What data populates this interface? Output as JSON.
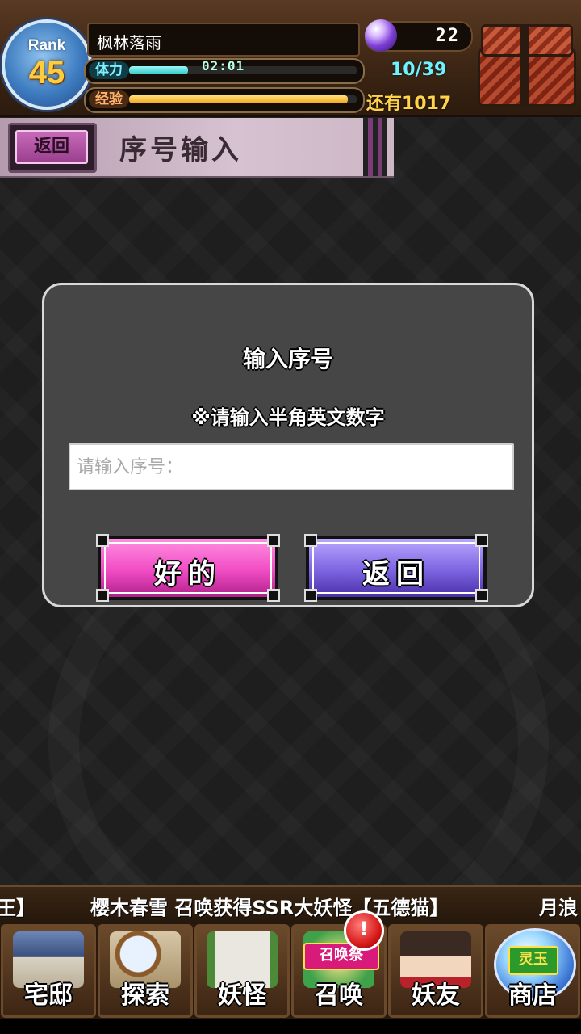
{
  "header": {
    "rank_label": "Rank",
    "rank_level": "45",
    "player_name": "枫林落雨",
    "stamina_label": "体力",
    "stamina_timer": "02:01",
    "stamina_count": "10/39",
    "stamina_fill_fraction": 0.26,
    "exp_label": "经验",
    "exp_remaining": "还有1017",
    "exp_fill_fraction": 0.96,
    "gem_count": "22"
  },
  "page": {
    "back_label": "返回",
    "title": "序号输入"
  },
  "dialog": {
    "title": "输入序号",
    "note": "※请输入半角英文数字",
    "input_placeholder": "请输入序号：",
    "input_value": "",
    "ok_label": "好的",
    "cancel_label": "返回"
  },
  "ticker": {
    "left_fragment": "王】",
    "message": "樱木春雪 召唤获得SSR大妖怪【五德猫】",
    "right_fragment": "月浪"
  },
  "bottom_nav": {
    "items": [
      {
        "label": "宅邸",
        "icon": "mansion-icon"
      },
      {
        "label": "探索",
        "icon": "magnifier-map-icon"
      },
      {
        "label": "妖怪",
        "icon": "yokai-scroll-icon"
      },
      {
        "label": "召唤",
        "icon": "summon-festival-icon",
        "tag": "召唤祭",
        "badge": "!"
      },
      {
        "label": "妖友",
        "icon": "fox-girl-icon"
      },
      {
        "label": "商店",
        "icon": "spirit-orb-icon",
        "tag": "灵玉"
      }
    ]
  },
  "colors": {
    "ok_button": "#f04cc4",
    "cancel_button": "#7c64e0",
    "stamina_bar": "#35c7c7",
    "exp_bar": "#f2a420"
  }
}
